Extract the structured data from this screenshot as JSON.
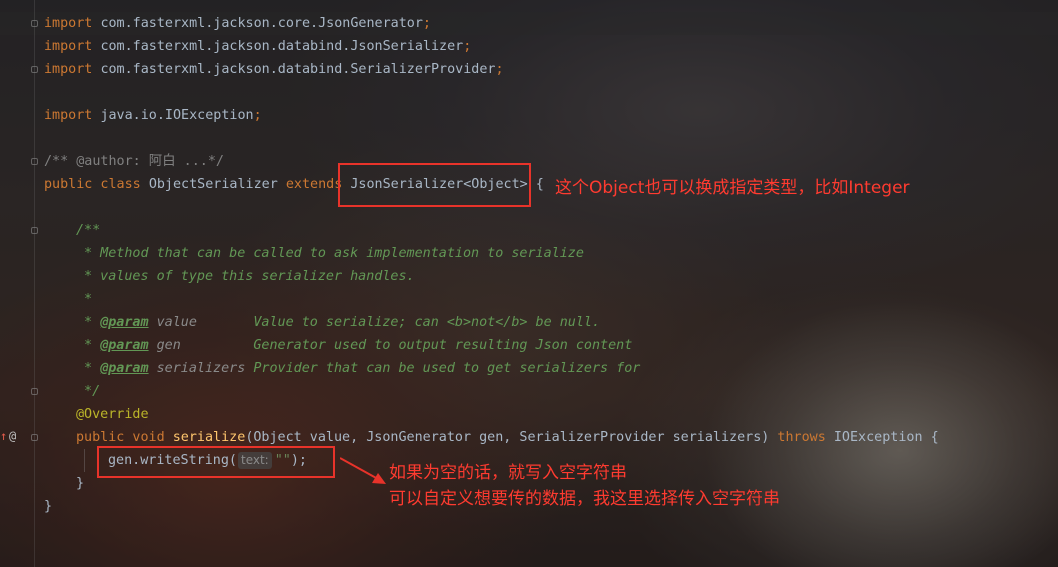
{
  "editor": {
    "imports": [
      {
        "kw": "import",
        "path": "com.fasterxml.jackson.core.JsonGenerator",
        "semi": ";"
      },
      {
        "kw": "import",
        "path": "com.fasterxml.jackson.databind.JsonSerializer",
        "semi": ";"
      },
      {
        "kw": "import",
        "path": "com.fasterxml.jackson.databind.SerializerProvider",
        "semi": ";"
      },
      {
        "kw": "import",
        "path": "java.io.IOException",
        "semi": ";"
      }
    ],
    "author_comment": "/** @author: 阿白 ...*/",
    "class_decl": {
      "modifiers": "public class ",
      "name": "ObjectSerializer ",
      "extends_kw": "extends ",
      "super_type": "JsonSerializer<Object>",
      "brace": " {"
    },
    "javadoc": {
      "open": "/**",
      "line1": " * Method that can be called to ask implementation to serialize",
      "line2": " * values of type this serializer handles.",
      "line3": " *",
      "params": [
        {
          "star": " * ",
          "tag": "@param",
          "name": " value       ",
          "desc": "Value to serialize; can <b>not</b> be null."
        },
        {
          "star": " * ",
          "tag": "@param",
          "name": " gen         ",
          "desc": "Generator used to output resulting Json content"
        },
        {
          "star": " * ",
          "tag": "@param",
          "name": " serializers ",
          "desc": "Provider that can be used to get serializers for"
        }
      ],
      "close": " */"
    },
    "annotation": "@Override",
    "method": {
      "modifiers": "public void ",
      "name": "serialize",
      "params": "(Object value, JsonGenerator gen, SerializerProvider serializers) ",
      "throws_kw": "throws ",
      "exception": "IOException {"
    },
    "body": {
      "call": "gen.writeString(",
      "hint": "text:",
      "arg": "\"\"",
      "end": ");"
    },
    "method_close": "}",
    "class_close": "}",
    "gutter_icons": {
      "override": "↑",
      "annotation": "@"
    }
  },
  "annotations": {
    "note1": "这个Object也可以换成指定类型，比如Integer",
    "note2_line1": "如果为空的话，就写入空字符串",
    "note2_line2": "可以自定义想要传的数据，我这里选择传入空字符串"
  },
  "colors": {
    "annotation_red": "#e8332a",
    "keyword": "#cc7832",
    "string": "#6a8759",
    "doc": "#629755",
    "function": "#ffc66d",
    "default_text": "#a9b7c6"
  }
}
